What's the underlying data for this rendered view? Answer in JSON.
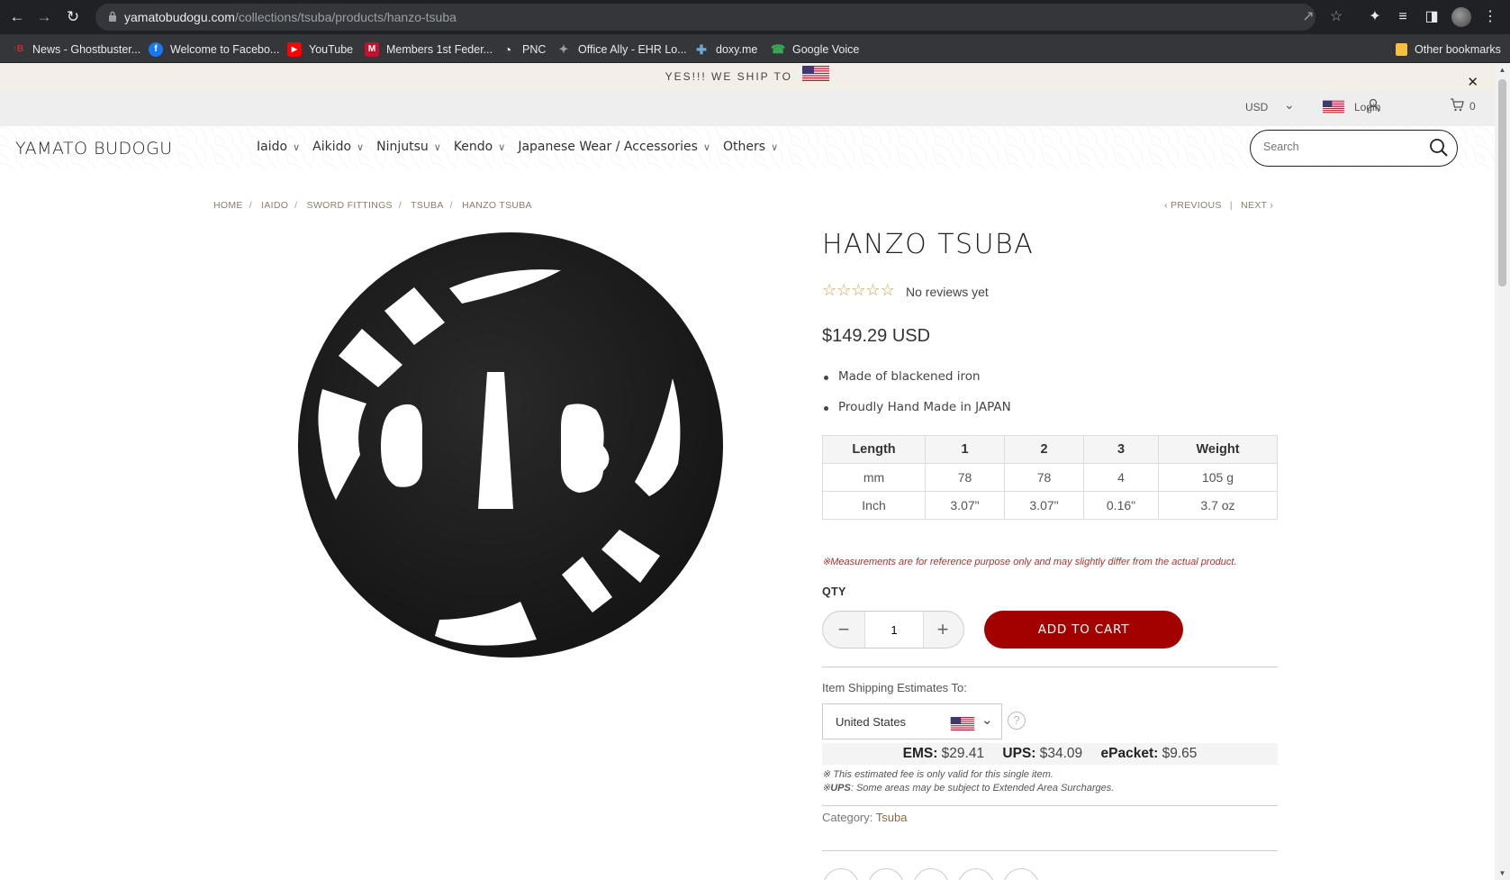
{
  "browser": {
    "url_host": "yamatobudogu.com",
    "url_path": "/collections/tsuba/products/hanzo-tsuba",
    "bookmarks": [
      {
        "label": "News - Ghostbuster...",
        "icon": "ghostbusters-icon",
        "color": "#c4302b",
        "glyph": "↑B"
      },
      {
        "label": "Welcome to Facebo...",
        "icon": "facebook-icon",
        "color": "#1877f2",
        "glyph": "f"
      },
      {
        "label": "YouTube",
        "icon": "youtube-icon",
        "color": "#ff0000",
        "glyph": "▶"
      },
      {
        "label": "Members 1st Feder...",
        "icon": "members1st-icon",
        "color": "#c8102e",
        "glyph": "M"
      },
      {
        "label": "PNC",
        "icon": "pnc-icon",
        "color": "#e8eaed",
        "glyph": "◔"
      },
      {
        "label": "Office Ally - EHR Lo...",
        "icon": "officeally-icon",
        "color": "#9aa0a6",
        "glyph": "✦"
      },
      {
        "label": "doxy.me",
        "icon": "doxy-icon",
        "color": "#6fa8dc",
        "glyph": "✚"
      },
      {
        "label": "Google Voice",
        "icon": "google-voice-icon",
        "color": "#34a853",
        "glyph": "☎"
      }
    ],
    "other_bookmarks": "Other bookmarks"
  },
  "announcement": {
    "text": "YES!!! WE SHIP TO",
    "close": "✕"
  },
  "topbar": {
    "currency": "USD",
    "login": "Login",
    "cart_count": "0"
  },
  "header": {
    "logo": "YAMATO BUDOGU",
    "menu": [
      "Iaido",
      "Aikido",
      "Ninjutsu",
      "Kendo",
      "Japanese Wear / Accessories",
      "Others"
    ],
    "search_placeholder": "Search"
  },
  "breadcrumb": [
    "HOME",
    "IAIDO",
    "SWORD FITTINGS",
    "TSUBA",
    "HANZO TSUBA"
  ],
  "pager": {
    "previous": "PREVIOUS",
    "next": "NEXT"
  },
  "product": {
    "title": "HANZO TSUBA",
    "rating_stars": 0,
    "reviews": "No reviews yet",
    "price": "$149.29 USD",
    "features": [
      "Made of blackened iron",
      "Proudly Hand Made in JAPAN"
    ],
    "spec_table": {
      "headers": [
        "Length",
        "1",
        "2",
        "3",
        "Weight"
      ],
      "rows": [
        [
          "mm",
          "78",
          "78",
          "4",
          "105 g"
        ],
        [
          "Inch",
          "3.07\"",
          "3.07\"",
          "0.16\"",
          "3.7 oz"
        ]
      ]
    },
    "measurement_note": "※Measurements are for reference purpose only and may slightly differ from the actual product.",
    "qty_label": "QTY",
    "qty_value": "1",
    "add_to_cart": "ADD TO CART"
  },
  "shipping": {
    "label": "Item Shipping Estimates To:",
    "country": "United States",
    "rates": [
      {
        "carrier": "EMS:",
        "price": "$29.41"
      },
      {
        "carrier": "UPS:",
        "price": "$34.09"
      },
      {
        "carrier": "ePacket:",
        "price": "$9.65"
      }
    ],
    "note1": "※ This estimated fee is only valid for this single item.",
    "note2_carrier": "UPS",
    "note2_text": ": Some areas may be subject to Extended Area Surcharges.",
    "note2_prefix": "※"
  },
  "category": {
    "label": "Category:",
    "value": "Tsuba"
  },
  "colors": {
    "accent": "#a30000",
    "chrome": "#202124",
    "announce_bg": "#f3efe6",
    "link": "#8b7d6b"
  }
}
